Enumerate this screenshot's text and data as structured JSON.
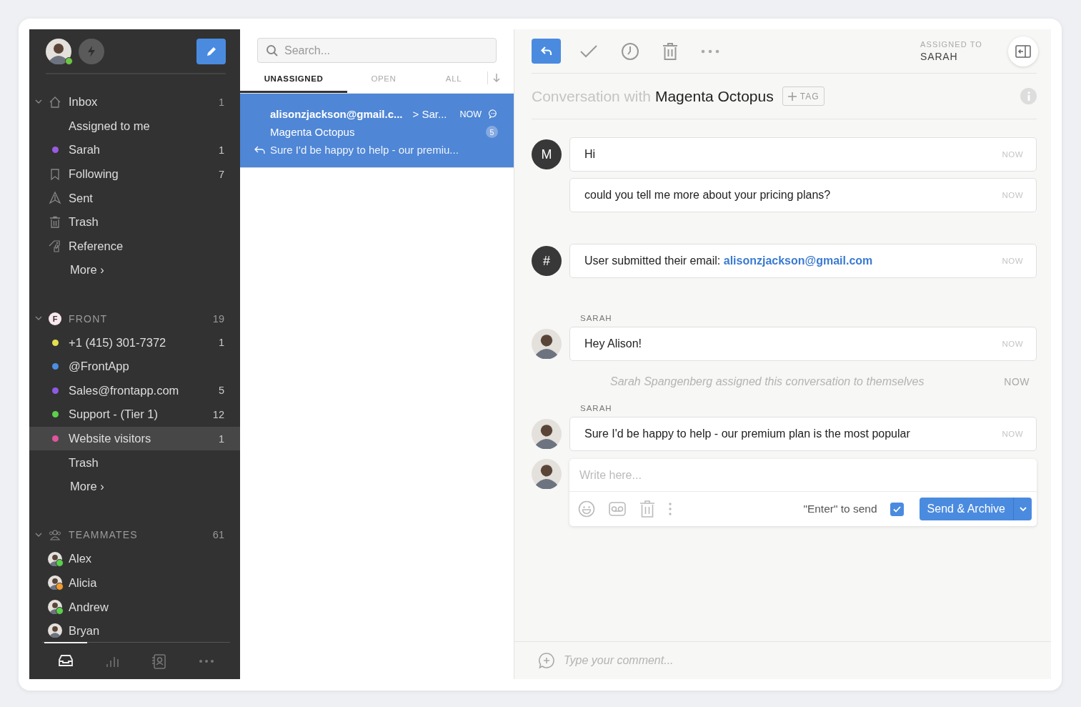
{
  "sidebar": {
    "user": {
      "online": true
    },
    "groups": [
      {
        "label": "Inbox",
        "count": "1",
        "expanded": true,
        "kind": "inbox",
        "items": [
          {
            "kind": "plain",
            "label": "Assigned to me",
            "selected": false
          },
          {
            "kind": "dot",
            "label": "Sarah",
            "count": "1",
            "color": "#9a5be3",
            "selected": false
          },
          {
            "kind": "icon",
            "label": "Following",
            "count": "7",
            "selected": false
          },
          {
            "kind": "icon",
            "label": "Sent",
            "selected": false
          },
          {
            "kind": "icon",
            "label": "Trash",
            "selected": false
          },
          {
            "kind": "icon",
            "label": "Reference",
            "selected": false
          },
          {
            "kind": "more",
            "label": "More ›",
            "selected": false
          }
        ]
      },
      {
        "label": "FRONT",
        "badge": "F",
        "count": "19",
        "expanded": true,
        "kind": "team",
        "items": [
          {
            "kind": "dot",
            "label": "+1 (415) 301-7372",
            "count": "1",
            "color": "#e3df4f",
            "selected": false
          },
          {
            "kind": "dot",
            "label": "@FrontApp",
            "color": "#4b8fe2",
            "selected": false
          },
          {
            "kind": "dot",
            "label": "Sales@frontapp.com",
            "count": "5",
            "color": "#8d5be3",
            "selected": false
          },
          {
            "kind": "dot",
            "label": "Support - (Tier 1)",
            "count": "12",
            "color": "#5ccf4b",
            "selected": false
          },
          {
            "kind": "dot",
            "label": "Website visitors",
            "count": "1",
            "color": "#e0559c",
            "selected": true
          },
          {
            "kind": "plain",
            "label": "Trash",
            "selected": false
          },
          {
            "kind": "more",
            "label": "More ›",
            "selected": false
          }
        ]
      },
      {
        "label": "TEAMMATES",
        "count": "61",
        "expanded": true,
        "kind": "people",
        "items": [
          {
            "kind": "avatar",
            "label": "Alex",
            "color": "#5ccf4b",
            "selected": false
          },
          {
            "kind": "avatar",
            "label": "Alicia",
            "color": "#f29b2c",
            "selected": false
          },
          {
            "kind": "avatar",
            "label": "Andrew",
            "color": "#5ccf4b",
            "selected": false
          },
          {
            "kind": "avatar",
            "label": "Bryan",
            "selected": false
          }
        ]
      }
    ],
    "bottom_nav": [
      {
        "selected": true
      },
      {
        "selected": false
      },
      {
        "selected": false
      },
      {
        "selected": false
      }
    ]
  },
  "list": {
    "search": {
      "placeholder": "Search..."
    },
    "tabs": [
      {
        "label": "UNASSIGNED",
        "selected": true
      },
      {
        "label": "OPEN",
        "selected": false
      },
      {
        "label": "ALL",
        "selected": false
      }
    ],
    "conversations": [
      {
        "from": "alisonzjackson@gmail.c...",
        "to": "> Sar...",
        "time": "NOW",
        "subject": "Magenta Octopus",
        "preview": "Sure I'd be happy to help - our premiu...",
        "count": "5",
        "replied": true,
        "selected": true
      }
    ]
  },
  "conversation": {
    "assigned_label": "ASSIGNED TO",
    "assignee": "SARAH",
    "title_prefix": "Conversation with",
    "title": "Magenta Octopus",
    "tag_label": "TAG",
    "messages": [
      {
        "kind": "message",
        "avatar": "M",
        "text": "Hi",
        "time": "NOW"
      },
      {
        "kind": "message",
        "text": "could you tell me more about your pricing plans?",
        "time": "NOW"
      },
      {
        "kind": "event",
        "avatar": "#",
        "text": "User submitted their email: **alisonzjackson@gmail.com**",
        "time": "NOW"
      },
      {
        "kind": "message",
        "author": "SARAH",
        "photo": true,
        "text": "Hey Alison!",
        "time": "NOW"
      },
      {
        "kind": "activity",
        "text": "Sarah Spangenberg assigned this conversation to themselves",
        "time": "NOW"
      },
      {
        "kind": "message",
        "author": "SARAH",
        "photo": true,
        "text": "Sure I'd be happy to help - our premium plan is the most popular",
        "time": "NOW"
      }
    ],
    "composer": {
      "placeholder": "Write here...",
      "enter_label": "\"Enter\" to send",
      "enter_checked": true,
      "send_label": "Send & Archive"
    },
    "comment": {
      "placeholder": "Type your comment..."
    }
  }
}
